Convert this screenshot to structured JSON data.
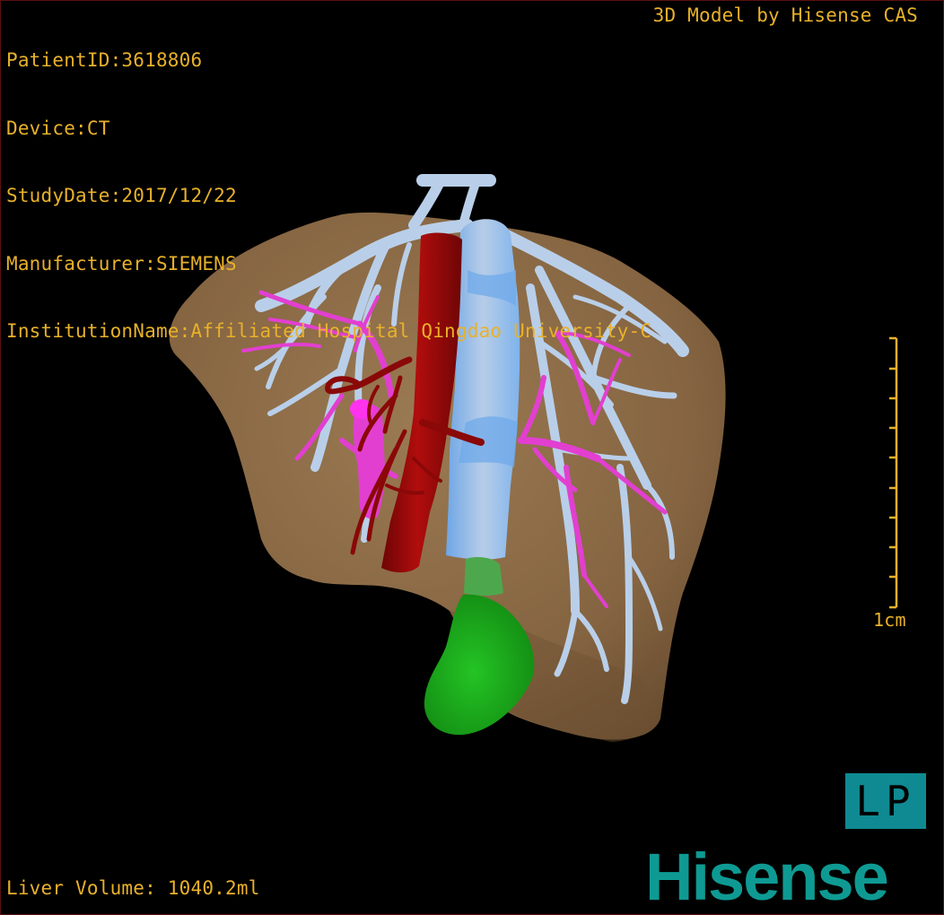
{
  "header": {
    "patient_id": "PatientID:3618806",
    "device": "Device:CT",
    "study_date": "StudyDate:2017/12/22",
    "manufacturer": "Manufacturer:SIEMENS",
    "institution": "InstitutionName:Affiliated Hospital Qingdao University-C"
  },
  "credit": "3D Model by Hisense CAS",
  "footer": {
    "liver_volume": "Liver Volume: 1040.2ml"
  },
  "scale_bar": {
    "label": "1cm"
  },
  "orientation": {
    "label": "LP"
  },
  "brand": {
    "name": "Hisense"
  },
  "colors": {
    "text": "#e8b12a",
    "liver": "#8a6a45",
    "hepatic_vein": "#b9cfe9",
    "portal_vein": "#e23fd0",
    "aorta": "#a30a0a",
    "ivc": "#7fb3ec",
    "tumor": "#1aa51a",
    "brand": "#0e9a93"
  },
  "model_parts": [
    "liver",
    "hepatic-vein",
    "portal-vein",
    "aorta",
    "inferior-vena-cava",
    "tumor"
  ]
}
